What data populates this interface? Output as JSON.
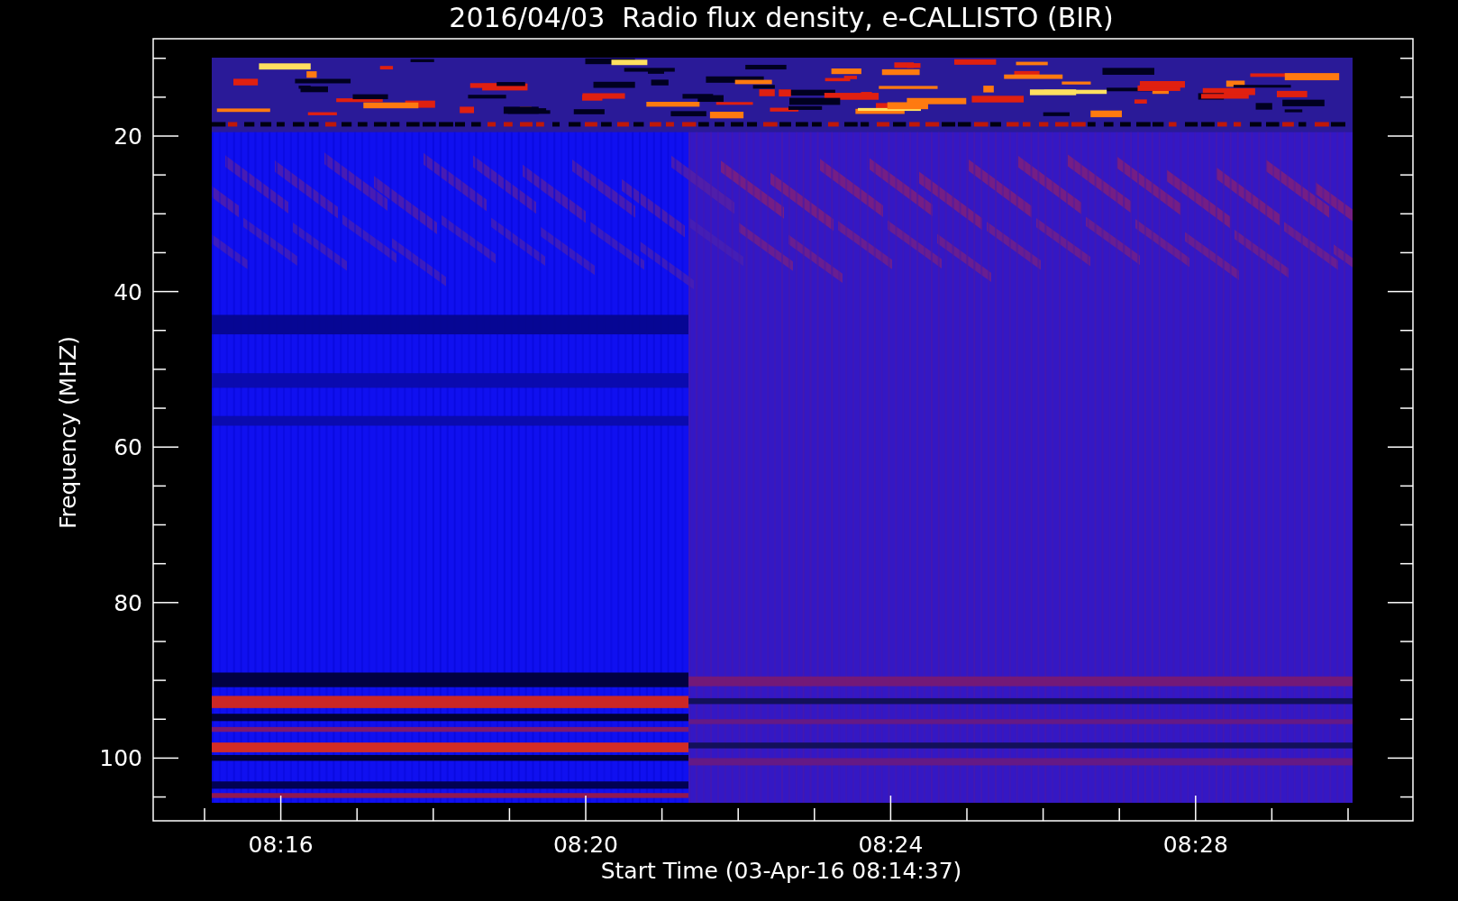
{
  "plot": {
    "title": "2016/04/03  Radio flux density, e-CALLISTO (BIR)",
    "xlabel": "Start Time (03-Apr-16 08:14:37)",
    "ylabel": "Frequency (MHZ)",
    "xtick_labels": [
      "08:16",
      "08:20",
      "08:24",
      "08:28"
    ],
    "ytick_labels": [
      "20",
      "40",
      "60",
      "80",
      "100"
    ]
  }
}
